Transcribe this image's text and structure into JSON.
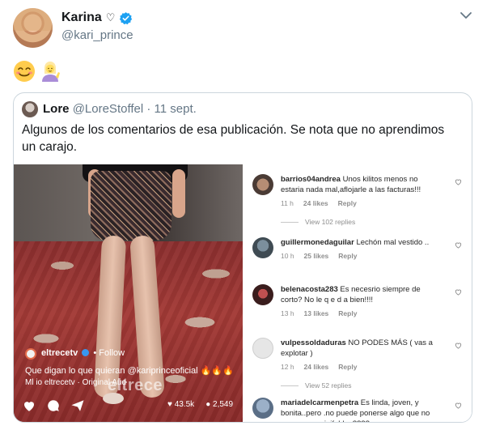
{
  "author": {
    "display_name": "Karina",
    "badge_symbol": "♡",
    "handle": "@kari_prince"
  },
  "emojis": [
    "smiling-face-with-smiling-eyes",
    "woman-tipping-hand"
  ],
  "quoted_tweet": {
    "name": "Lore",
    "handle": "@LoreStoffel",
    "separator": "·",
    "date": "11 sept.",
    "text": "Algunos de los comentarios de esa publicación. Se nota que no aprendimos un carajo."
  },
  "video_post": {
    "account": "eltrecetv",
    "follow": "• Follow",
    "caption": "Que digan lo que quieran @kariprinceoficial 🔥🔥🔥",
    "audio": "Ml io     eltrecetv · Original Aud",
    "brand": "eltrece",
    "views": "43.5k",
    "comments_count": "2,549"
  },
  "comments": [
    {
      "user": "barrios04andrea",
      "text": "Unos kilitos menos no estaria nada mal,aflojarle a las facturas!!!",
      "time": "11 h",
      "likes": "24 likes",
      "reply": "Reply",
      "view_replies": "View 102 replies"
    },
    {
      "user": "guillermonedaguilar",
      "text": "Lechón mal vestido ..",
      "time": "10 h",
      "likes": "25 likes",
      "reply": "Reply"
    },
    {
      "user": "belenacosta283",
      "text": "Es necesrio siempre de corto? No le q e d a bien!!!!",
      "time": "13 h",
      "likes": "13 likes",
      "reply": "Reply"
    },
    {
      "user": "vulpessoldaduras",
      "text": "NO PODES MÁS ( vas a explotar )",
      "time": "12 h",
      "likes": "24 likes",
      "reply": "Reply",
      "view_replies": "View 52 replies"
    },
    {
      "user": "mariadelcarmenpetra",
      "text": "Es linda, joven, y bonita..pero .no puede ponerse algo que no sean esas minifaldas????"
    }
  ],
  "colors": {
    "verified": "#1da1f2",
    "text_primary": "#14171a",
    "text_secondary": "#657786",
    "border": "#ccd6dd"
  }
}
